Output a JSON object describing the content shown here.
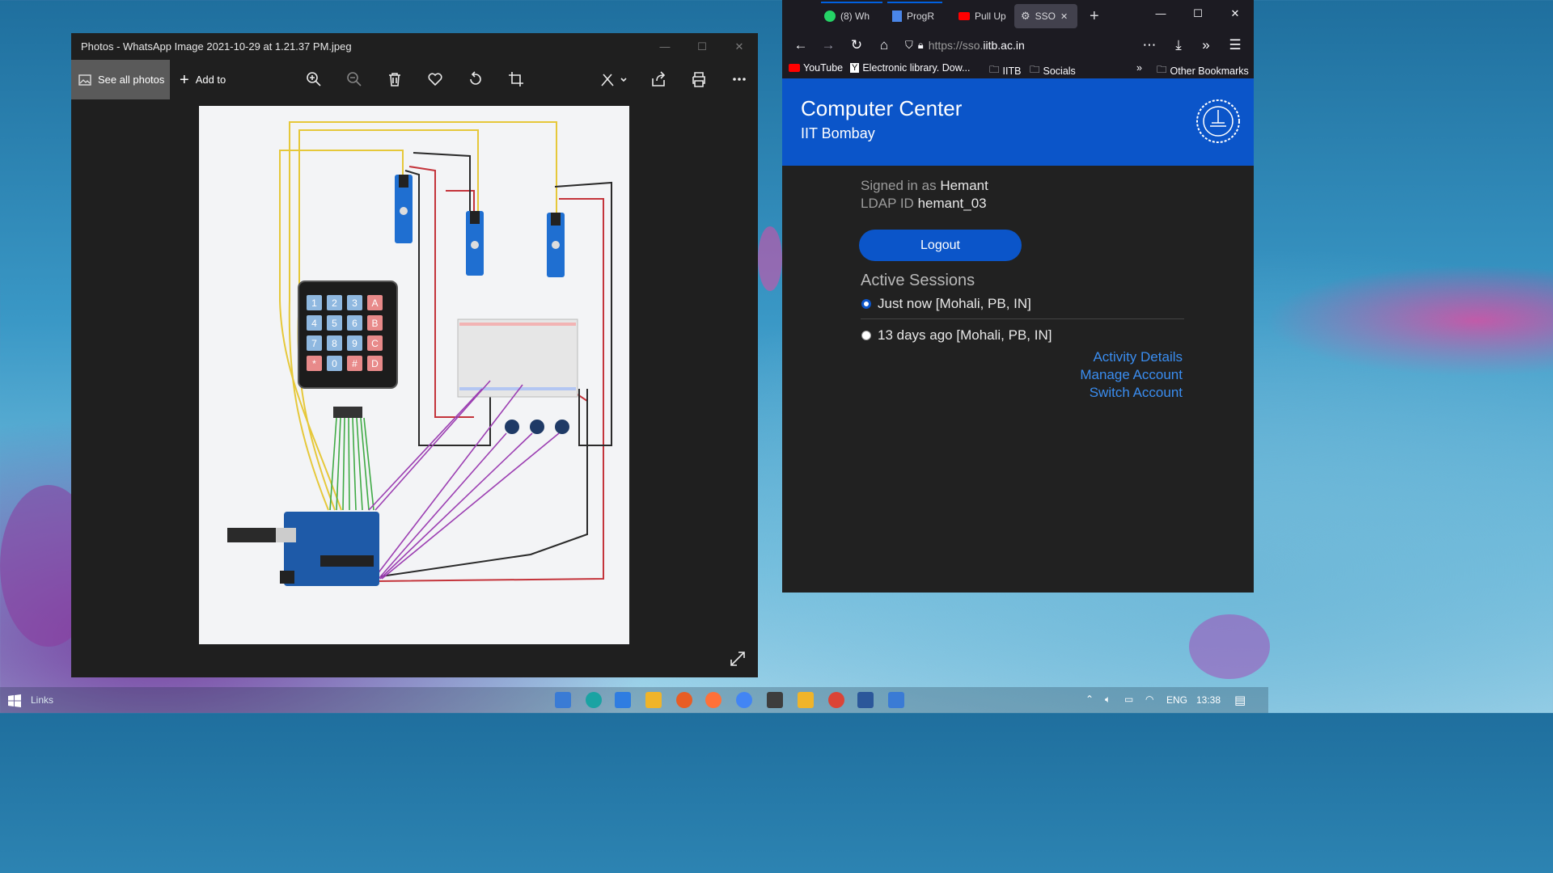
{
  "photos": {
    "title": "Photos - WhatsApp Image 2021-10-29 at 1.21.37 PM.jpeg",
    "see_all": "See all photos",
    "add_to": "Add to"
  },
  "keypad": [
    "1",
    "2",
    "3",
    "A",
    "4",
    "5",
    "6",
    "B",
    "7",
    "8",
    "9",
    "C",
    "*",
    "0",
    "#",
    "D"
  ],
  "firefox": {
    "tabs": [
      {
        "label": "(8) Wh"
      },
      {
        "label": "ProgR"
      },
      {
        "label": "Pull Up"
      },
      {
        "label": "SSO"
      }
    ],
    "url_prefix": "https://sso.",
    "url_host": "iitb.ac.in",
    "bookmarks": [
      "YouTube",
      "Electronic library. Dow...",
      "IITB",
      "Socials",
      "Other Bookmarks"
    ]
  },
  "page": {
    "title": "Computer Center",
    "subtitle": "IIT Bombay",
    "signed_in_label": "Signed in as",
    "user": "Hemant",
    "ldap_label": "LDAP ID",
    "ldap": "hemant_03",
    "logout": "Logout",
    "active_sessions": "Active Sessions",
    "sessions": [
      "Just now [Mohali, PB, IN]",
      "13 days ago [Mohali, PB, IN]"
    ],
    "links": [
      "Activity Details",
      "Manage Account",
      "Switch Account"
    ]
  },
  "taskbar": {
    "search": "Links",
    "lang": "ENG",
    "time": "13:38"
  }
}
